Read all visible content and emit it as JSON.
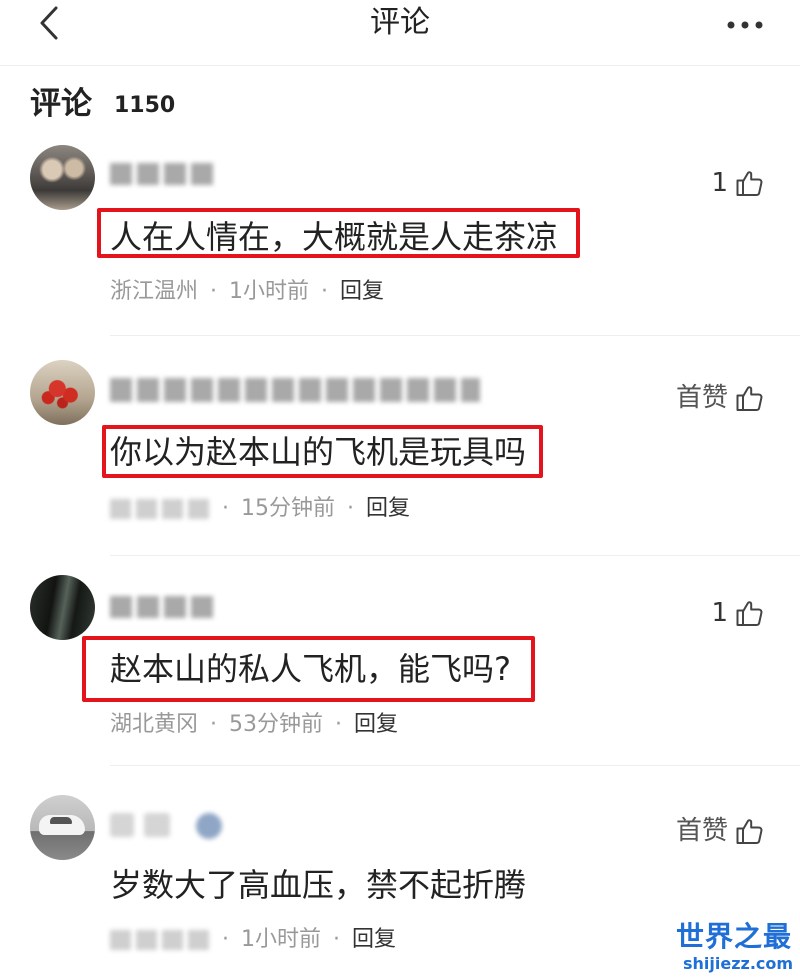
{
  "nav": {
    "title": "评论",
    "back_icon": "chevron-left-icon",
    "more_icon": "more-dots-icon"
  },
  "header": {
    "label": "评论",
    "count": "1150"
  },
  "meta_separator": "·",
  "like_icon": "thumbs-up-icon",
  "comments": [
    {
      "likes_label": "1",
      "text": "人在人情在，大概就是人走茶凉",
      "highlighted": true,
      "location": "浙江温州",
      "time": "1小时前",
      "reply": "回复"
    },
    {
      "likes_label": "首赞",
      "text": "你以为赵本山的飞机是玩具吗",
      "highlighted": true,
      "time": "15分钟前",
      "reply": "回复"
    },
    {
      "likes_label": "1",
      "text": "赵本山的私人飞机，能飞吗?",
      "highlighted": true,
      "location": "湖北黄冈",
      "time": "53分钟前",
      "reply": "回复"
    },
    {
      "likes_label": "首赞",
      "text": "岁数大了高血压，禁不起折腾",
      "highlighted": false,
      "time": "1小时前",
      "reply": "回复"
    }
  ],
  "watermark": {
    "title": "世界之最",
    "url": "shijiezz.com"
  },
  "colors": {
    "text": "#222222",
    "meta": "#999999",
    "reply": "#333333",
    "highlight": "#e3141b",
    "watermark": "#1f6fd6"
  }
}
